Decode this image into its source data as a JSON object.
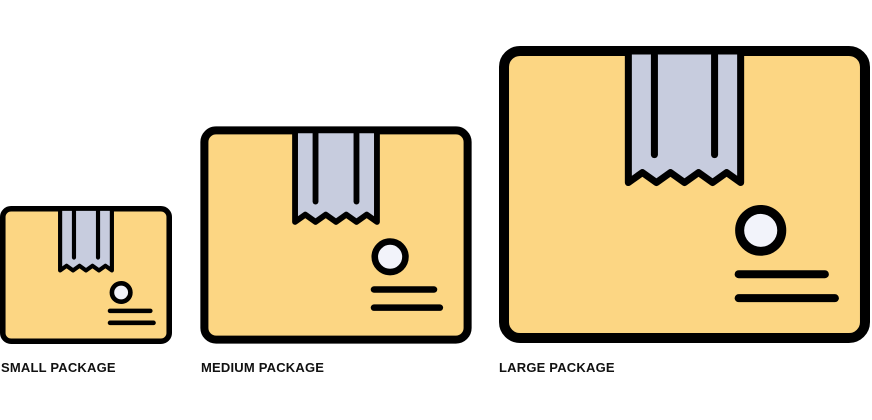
{
  "packages": [
    {
      "id": "small",
      "label": "SMALL PACKAGE"
    },
    {
      "id": "medium",
      "label": "MEDIUM PACKAGE"
    },
    {
      "id": "large",
      "label": "LARGE PACKAGE"
    }
  ],
  "icon": "cardboard-box-icon",
  "colors": {
    "box_fill": "#FCD683",
    "tape_fill": "#C7CCDE",
    "outline": "#000000",
    "circle_fill": "#F2F3FA",
    "background": "#FFFFFF"
  }
}
